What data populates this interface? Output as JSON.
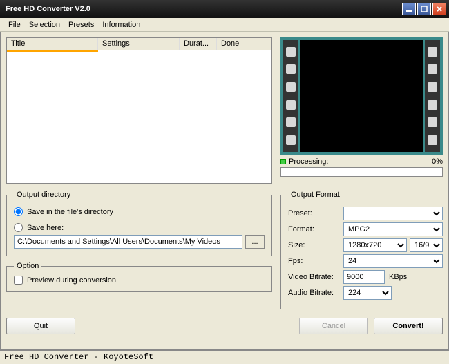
{
  "title": "Free HD Converter V2.0",
  "menu": {
    "file": "File",
    "selection": "Selection",
    "presets": "Presets",
    "information": "Information"
  },
  "filelist": {
    "cols": {
      "title": "Title",
      "settings": "Settings",
      "durat": "Durat...",
      "done": "Done"
    }
  },
  "processing": {
    "label": "Processing:",
    "pct": "0%"
  },
  "outdir": {
    "legend": "Output directory",
    "opt1": "Save in the file's directory",
    "opt2": "Save here:",
    "path": "C:\\Documents and Settings\\All Users\\Documents\\My Videos",
    "browse": "..."
  },
  "option": {
    "legend": "Option",
    "preview": "Preview during conversion"
  },
  "outfmt": {
    "legend": "Output Format",
    "preset_label": "Preset:",
    "preset": "",
    "format_label": "Format:",
    "format": "MPG2",
    "size_label": "Size:",
    "size": "1280x720",
    "aspect": "16/9",
    "fps_label": "Fps:",
    "fps": "24",
    "vbitrate_label": "Video Bitrate:",
    "vbitrate": "9000",
    "vbitrate_unit": "KBps",
    "abitrate_label": "Audio Bitrate:",
    "abitrate": "224"
  },
  "buttons": {
    "quit": "Quit",
    "cancel": "Cancel",
    "convert": "Convert!"
  },
  "status": "Free HD Converter - KoyoteSoft"
}
